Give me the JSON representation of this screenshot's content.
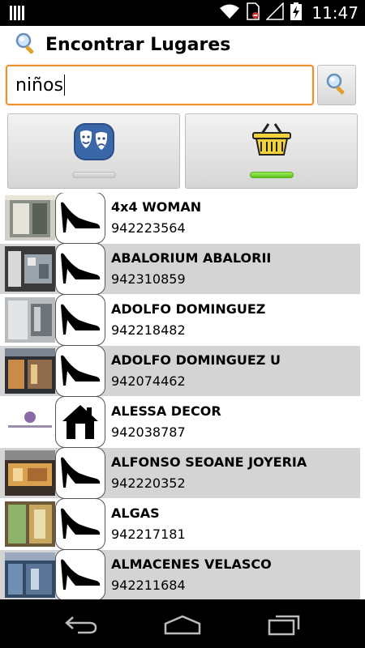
{
  "status_bar": {
    "time": "11:47",
    "icons": [
      "notification-bars-icon",
      "wifi-icon",
      "no-sim-icon",
      "signal-icon",
      "battery-charging-icon"
    ]
  },
  "header": {
    "icon": "search-icon",
    "title": "Encontrar Lugares"
  },
  "search": {
    "value": "niños",
    "button_icon": "search-icon",
    "accent_color": "#f0902a"
  },
  "categories": [
    {
      "name": "theatre-masks",
      "icon": "theatre-masks-icon",
      "selected": false
    },
    {
      "name": "shopping-basket",
      "icon": "shopping-basket-icon",
      "selected": true
    }
  ],
  "places": [
    {
      "name": "4x4 WOMAN",
      "phone": "942223564",
      "icon": "high-heel-shoe-icon"
    },
    {
      "name": "ABALORIUM ABALORII",
      "phone": "942310859",
      "icon": "high-heel-shoe-icon"
    },
    {
      "name": "ADOLFO DOMINGUEZ",
      "phone": "942218482",
      "icon": "high-heel-shoe-icon"
    },
    {
      "name": "ADOLFO DOMINGUEZ U",
      "phone": "942074462",
      "icon": "high-heel-shoe-icon"
    },
    {
      "name": "ALESSA DECOR",
      "phone": "942038787",
      "icon": "house-icon"
    },
    {
      "name": "ALFONSO SEOANE JOYERIA",
      "phone": "942220352",
      "icon": "high-heel-shoe-icon"
    },
    {
      "name": "ALGAS",
      "phone": "942217181",
      "icon": "high-heel-shoe-icon"
    },
    {
      "name": "ALMACENES VELASCO",
      "phone": "942211684",
      "icon": "high-heel-shoe-icon"
    }
  ],
  "nav_bar": {
    "buttons": [
      "back-icon",
      "home-icon",
      "recent-apps-icon"
    ]
  }
}
